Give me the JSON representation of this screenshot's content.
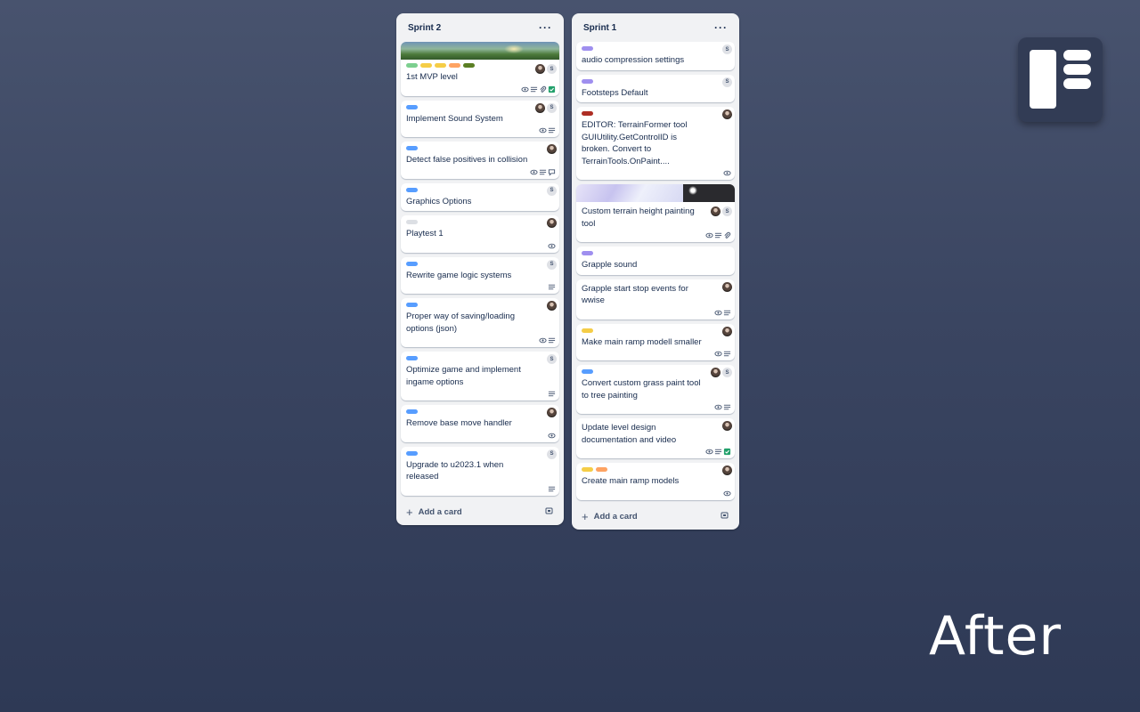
{
  "colors": {
    "green": "#7ccf8f",
    "yellow": "#f5cd47",
    "orange": "#fea362",
    "olive": "#5b7f24",
    "blue": "#579dff",
    "purple": "#9f8fef",
    "red": "#ae2e24",
    "gray": "#dcdfe4"
  },
  "lists": [
    {
      "title": "Sprint 2",
      "add_card": "Add a card",
      "cards": [
        {
          "title": "1st MVP level",
          "cover": "landscape",
          "labels": [
            "green",
            "yellow",
            "yellow",
            "orange",
            "olive"
          ],
          "members": [
            "photo",
            "S"
          ],
          "badges": [
            "eye",
            "desc",
            "attach",
            "check"
          ]
        },
        {
          "title": "Implement Sound System",
          "labels": [
            "blue"
          ],
          "members": [
            "photo",
            "S"
          ],
          "badges": [
            "eye",
            "desc"
          ]
        },
        {
          "title": "Detect false positives in collision",
          "labels": [
            "blue"
          ],
          "members": [
            "photo"
          ],
          "badges": [
            "eye",
            "desc",
            "comment"
          ]
        },
        {
          "title": "Graphics Options",
          "labels": [
            "blue"
          ],
          "members": [
            "S"
          ],
          "badges": []
        },
        {
          "title": "Playtest 1",
          "labels": [
            "gray"
          ],
          "members": [
            "photo"
          ],
          "badges": [
            "eye"
          ]
        },
        {
          "title": "Rewrite game logic systems",
          "labels": [
            "blue"
          ],
          "members": [
            "S"
          ],
          "badges": [
            "desc"
          ]
        },
        {
          "title": "Proper way of saving/loading options (json)",
          "labels": [
            "blue"
          ],
          "members": [
            "photo"
          ],
          "badges": [
            "eye",
            "desc"
          ]
        },
        {
          "title": "Optimize game and implement ingame options",
          "labels": [
            "blue"
          ],
          "members": [
            "S"
          ],
          "badges": [
            "desc"
          ]
        },
        {
          "title": "Remove base move handler",
          "labels": [
            "blue"
          ],
          "members": [
            "photo"
          ],
          "badges": [
            "eye"
          ]
        },
        {
          "title": "Upgrade to u2023.1 when released",
          "labels": [
            "blue"
          ],
          "members": [
            "S"
          ],
          "badges": [
            "desc"
          ]
        }
      ]
    },
    {
      "title": "Sprint 1",
      "add_card": "Add a card",
      "cards": [
        {
          "title": "audio compression settings",
          "labels": [
            "purple"
          ],
          "members": [
            "S"
          ],
          "badges": []
        },
        {
          "title": "Footsteps Default",
          "labels": [
            "purple"
          ],
          "members": [
            "S"
          ],
          "badges": []
        },
        {
          "title": "EDITOR: TerrainFormer tool GUIUtility.GetControlID is broken. Convert to TerrainTools.OnPaint....",
          "labels": [
            "red"
          ],
          "members": [
            "photo"
          ],
          "badges": [
            "eye"
          ]
        },
        {
          "title": "Custom terrain height painting tool",
          "cover": "split",
          "labels": [],
          "members": [
            "photo",
            "S"
          ],
          "badges": [
            "eye",
            "desc",
            "attach"
          ]
        },
        {
          "title": "Grapple sound",
          "labels": [
            "purple"
          ],
          "members": [],
          "badges": []
        },
        {
          "title": "Grapple start stop events for wwise",
          "labels": [],
          "members": [
            "photo"
          ],
          "badges": [
            "eye",
            "desc"
          ]
        },
        {
          "title": "Make main ramp modell smaller",
          "labels": [
            "yellow"
          ],
          "members": [
            "photo"
          ],
          "badges": [
            "eye",
            "desc"
          ]
        },
        {
          "title": "Convert custom grass paint tool to tree painting",
          "labels": [
            "blue"
          ],
          "members": [
            "photo",
            "S"
          ],
          "badges": [
            "eye",
            "desc"
          ]
        },
        {
          "title": "Update level design documentation and video",
          "labels": [],
          "members": [
            "photo"
          ],
          "badges": [
            "eye",
            "desc",
            "check"
          ]
        },
        {
          "title": "Create main ramp models",
          "labels": [
            "yellow",
            "orange"
          ],
          "members": [
            "photo"
          ],
          "badges": [
            "eye"
          ]
        }
      ]
    }
  ],
  "overlay_text": "After",
  "icons": {
    "menu": "more-horizontal-icon",
    "add": "plus-icon",
    "template": "card-template-icon",
    "logo": "trello-board-logo-icon"
  }
}
